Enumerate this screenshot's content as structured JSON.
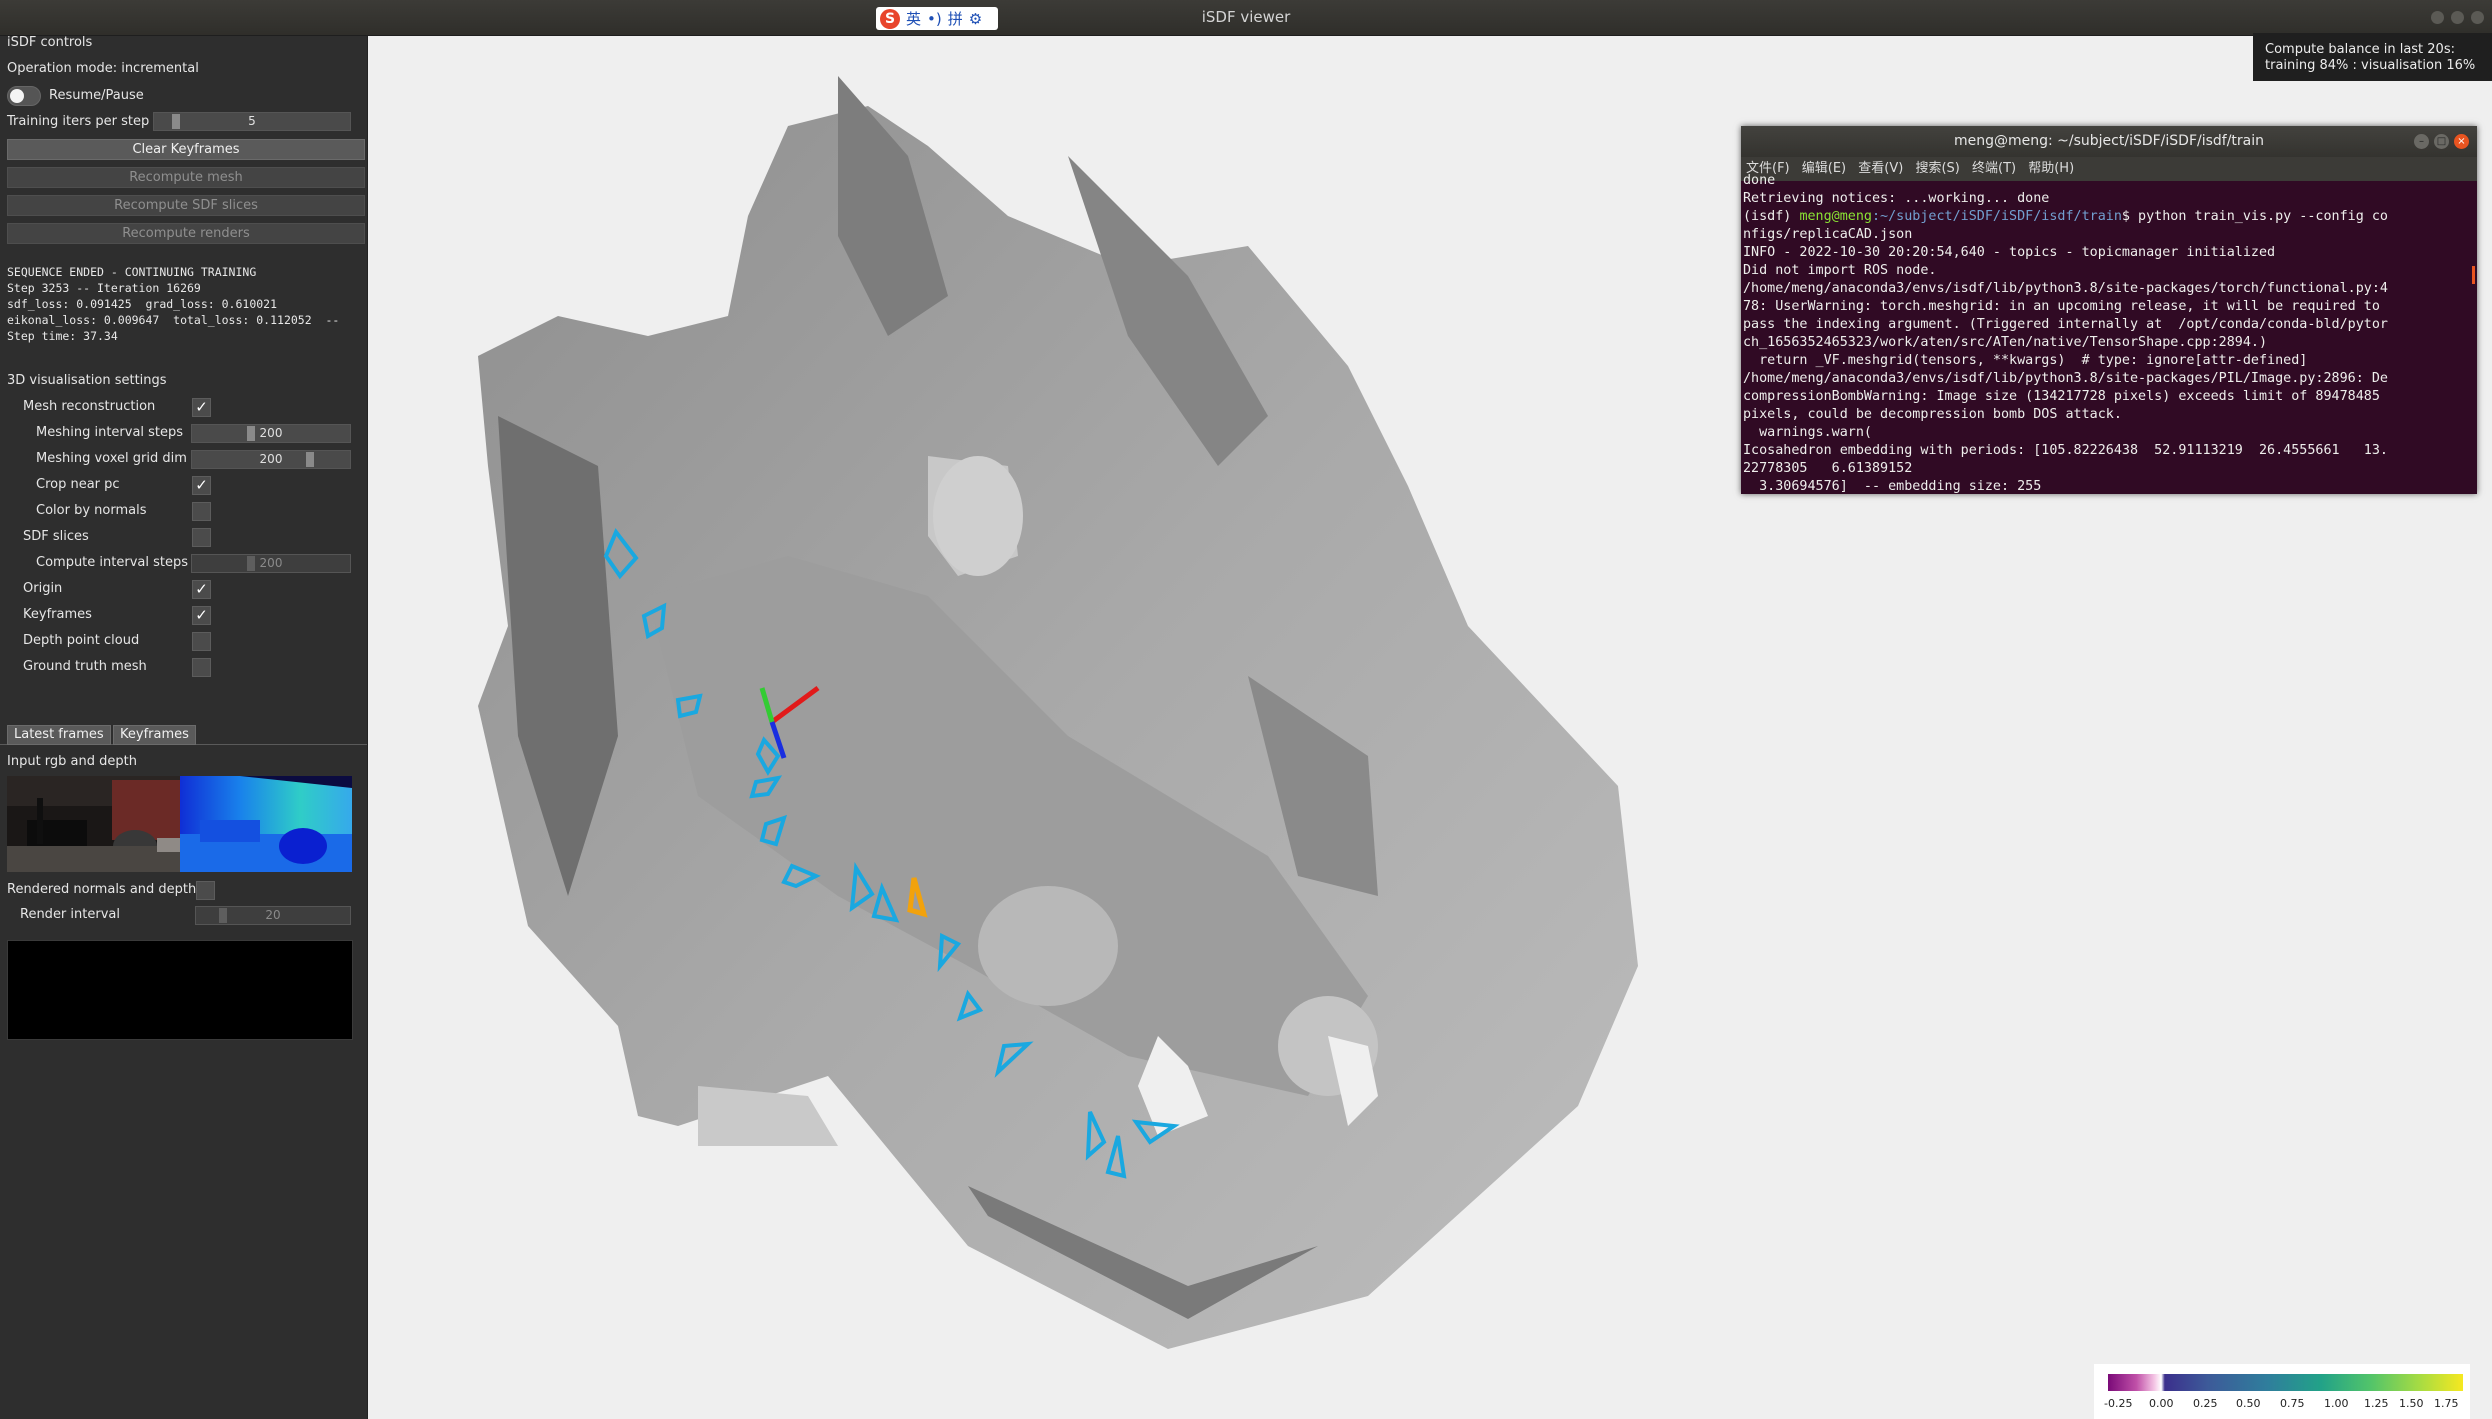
{
  "window": {
    "title": "iSDF viewer",
    "ime": {
      "logo": "S",
      "items": [
        "英",
        "•)",
        "拼",
        "⚙"
      ]
    }
  },
  "panel": {
    "heading": "iSDF controls",
    "operation_mode": "Operation mode: incremental",
    "resume_pause": "Resume/Pause",
    "training_iters_label": "Training iters per step",
    "training_iters_value": "5",
    "buttons": {
      "clear_keyframes": "Clear Keyframes",
      "recompute_mesh": "Recompute mesh",
      "recompute_sdf": "Recompute SDF slices",
      "recompute_renders": "Recompute renders"
    },
    "log": {
      "l1": "SEQUENCE ENDED - CONTINUING TRAINING",
      "l2": "Step 3253 -- Iteration 16269",
      "l3": "sdf_loss: 0.091425  grad_loss: 0.610021",
      "l4": "eikonal_loss: 0.009647  total_loss: 0.112052  --",
      "l5": "Step time: 37.34"
    },
    "vis_heading": "3D visualisation settings",
    "mesh_reconstruction": "Mesh reconstruction",
    "meshing_interval_label": "Meshing interval steps",
    "meshing_interval_value": "200",
    "meshing_voxel_label": "Meshing voxel grid dim",
    "meshing_voxel_value": "200",
    "crop_near_pc": "Crop near pc",
    "color_by_normals": "Color by normals",
    "sdf_slices": "SDF slices",
    "compute_interval_label": "Compute interval steps",
    "compute_interval_value": "200",
    "origin": "Origin",
    "keyframes": "Keyframes",
    "depth_point_cloud": "Depth point cloud",
    "ground_truth_mesh": "Ground truth mesh",
    "tabs": [
      "Latest frames",
      "Keyframes"
    ],
    "input_rgb_depth": "Input rgb and depth",
    "rendered_normals": "Rendered normals and depth",
    "render_interval_label": "Render interval",
    "render_interval_value": "20"
  },
  "stats": {
    "line1": "Compute balance in last 20s:",
    "line2": "training 84% : visualisation 16%"
  },
  "terminal": {
    "title": "meng@meng: ~/subject/iSDF/iSDF/isdf/train",
    "menu": [
      "文件(F)",
      "编辑(E)",
      "查看(V)",
      "搜索(S)",
      "终端(T)",
      "帮助(H)"
    ],
    "prompt_env": "(isdf) ",
    "prompt_user": "meng@meng",
    "prompt_path": ":~/subject/iSDF/iSDF/isdf/train",
    "prompt_cmd": "$ python train_vis.py --config co",
    "lines": {
      "l0": "done",
      "l1": "Retrieving notices: ...working... done",
      "l2": "nfigs/replicaCAD.json",
      "l3": "INFO - 2022-10-30 20:20:54,640 - topics - topicmanager initialized",
      "l4": "Did not import ROS node.",
      "l5": "/home/meng/anaconda3/envs/isdf/lib/python3.8/site-packages/torch/functional.py:4",
      "l6": "78: UserWarning: torch.meshgrid: in an upcoming release, it will be required to",
      "l7": "pass the indexing argument. (Triggered internally at  /opt/conda/conda-bld/pytor",
      "l8": "ch_1656352465323/work/aten/src/ATen/native/TensorShape.cpp:2894.)",
      "l9": "  return _VF.meshgrid(tensors, **kwargs)  # type: ignore[attr-defined]",
      "l10": "/home/meng/anaconda3/envs/isdf/lib/python3.8/site-packages/PIL/Image.py:2896: De",
      "l11": "compressionBombWarning: Image size (134217728 pixels) exceeds limit of 89478485",
      "l12": "pixels, could be decompression bomb DOS attack.",
      "l13": "  warnings.warn(",
      "l14": "Icosahedron embedding with periods: [105.82226438  52.91113219  26.4555661   13.",
      "l15": "22778305   6.61389152",
      "l16": "  3.30694576]  -- embedding size: 255"
    }
  },
  "colorbar": {
    "ticks": [
      "-0.25",
      "0.00",
      "0.25",
      "0.50",
      "0.75",
      "1.00",
      "1.25",
      "1.50",
      "1.75"
    ]
  },
  "colors": {
    "keyframe_camera": "#1aa8e0",
    "current_camera": "#f2a20c",
    "mesh": "#a8a8a8"
  }
}
